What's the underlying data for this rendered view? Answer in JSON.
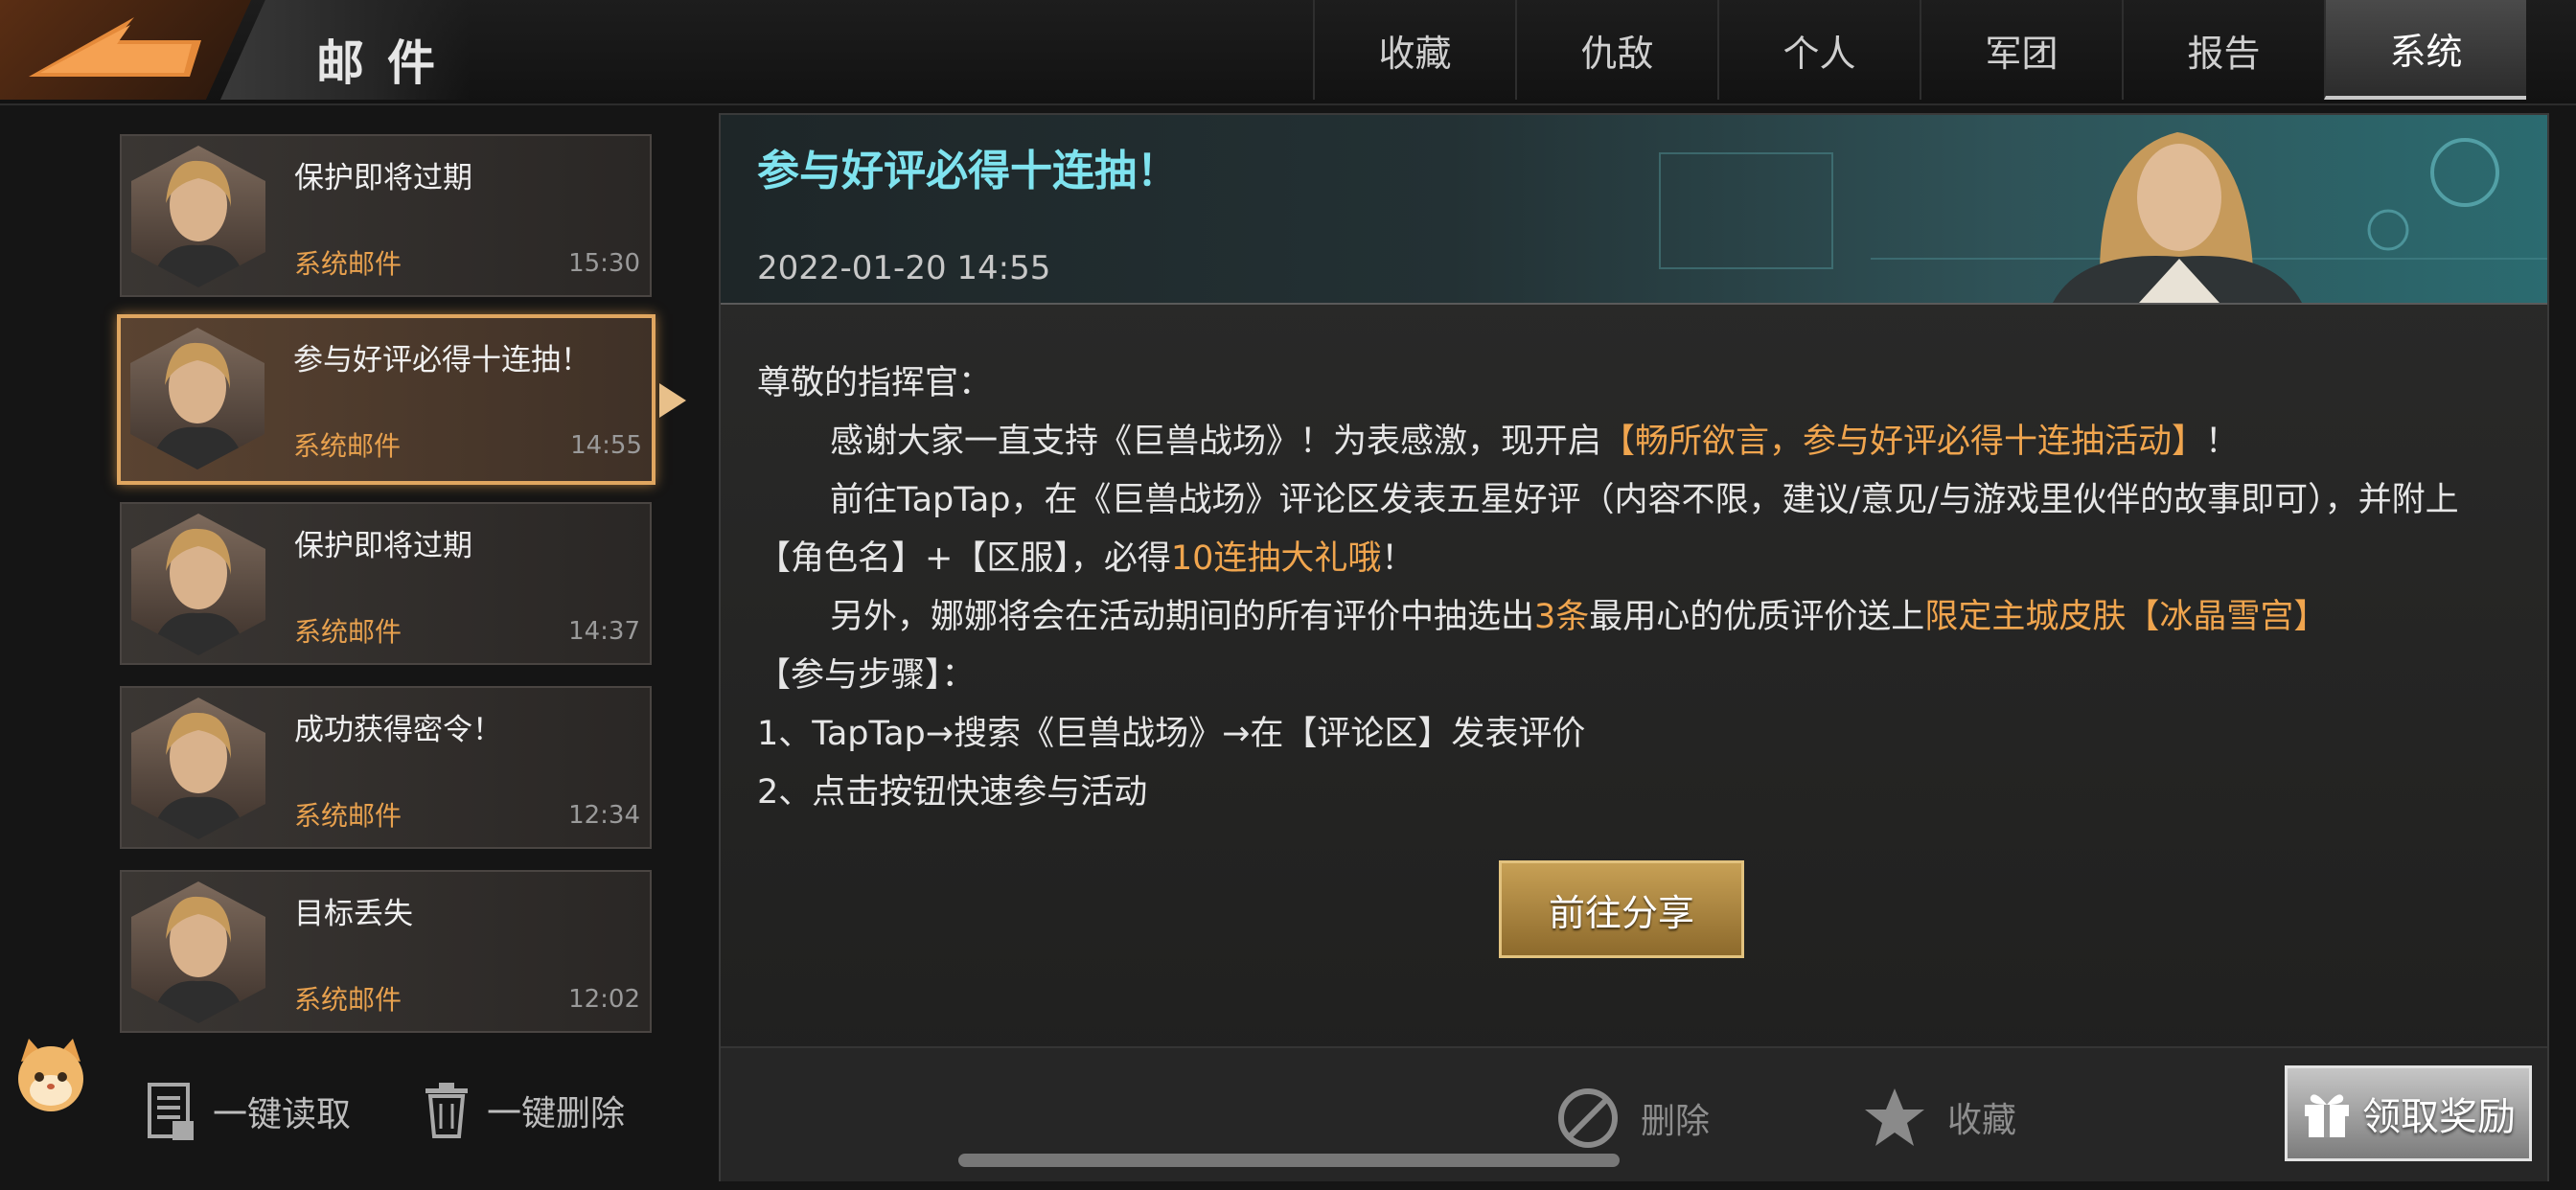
{
  "header": {
    "title": "邮件",
    "tabs": [
      {
        "label": "收藏",
        "active": false
      },
      {
        "label": "仇敌",
        "active": false
      },
      {
        "label": "个人",
        "active": false
      },
      {
        "label": "军团",
        "active": false
      },
      {
        "label": "报告",
        "active": false
      },
      {
        "label": "系统",
        "active": true
      }
    ]
  },
  "mail_list": [
    {
      "subject": "保护即将过期",
      "sender": "系统邮件",
      "time": "15:30",
      "selected": false
    },
    {
      "subject": "参与好评必得十连抽！",
      "sender": "系统邮件",
      "time": "14:55",
      "selected": true
    },
    {
      "subject": "保护即将过期",
      "sender": "系统邮件",
      "time": "14:37",
      "selected": false
    },
    {
      "subject": "成功获得密令！",
      "sender": "系统邮件",
      "time": "12:34",
      "selected": false
    },
    {
      "subject": "目标丢失",
      "sender": "系统邮件",
      "time": "12:02",
      "selected": false
    }
  ],
  "list_actions": {
    "read_all": "一键读取",
    "delete_all": "一键删除"
  },
  "detail": {
    "title": "参与好评必得十连抽！",
    "date": "2022-01-20  14:55",
    "greeting": "尊敬的指挥官：",
    "p1_a": "感谢大家一直支持《巨兽战场》！为表感激，现开启",
    "p1_hl": "【畅所欲言，参与好评必得十连抽活动】",
    "p1_b": "！",
    "p2_a": "前往TapTap，在《巨兽战场》评论区发表五星好评（内容不限，建议/意见/与游戏里伙伴的故事即可），并附上【角色名】+【区服】，必得",
    "p2_hl": "10连抽大礼哦",
    "p2_b": "！",
    "p3_a": "另外，娜娜将会在活动期间的所有评价中抽选出",
    "p3_hl1": "3条",
    "p3_b": "最用心的优质评价送上",
    "p3_hl2": "限定主城皮肤【冰晶雪宫】",
    "steps_title": "【参与步骤】：",
    "step1": "1、TapTap→搜索《巨兽战场》→在【评论区】发表评价",
    "step2": "2、点击按钮快速参与活动",
    "share_button": "前往分享"
  },
  "footer": {
    "delete": "删除",
    "favorite": "收藏",
    "claim": "领取奖励"
  },
  "colors": {
    "accent_orange": "#e8a14e",
    "title_cyan": "#7fe3ef",
    "selected_border": "#e0a660"
  }
}
